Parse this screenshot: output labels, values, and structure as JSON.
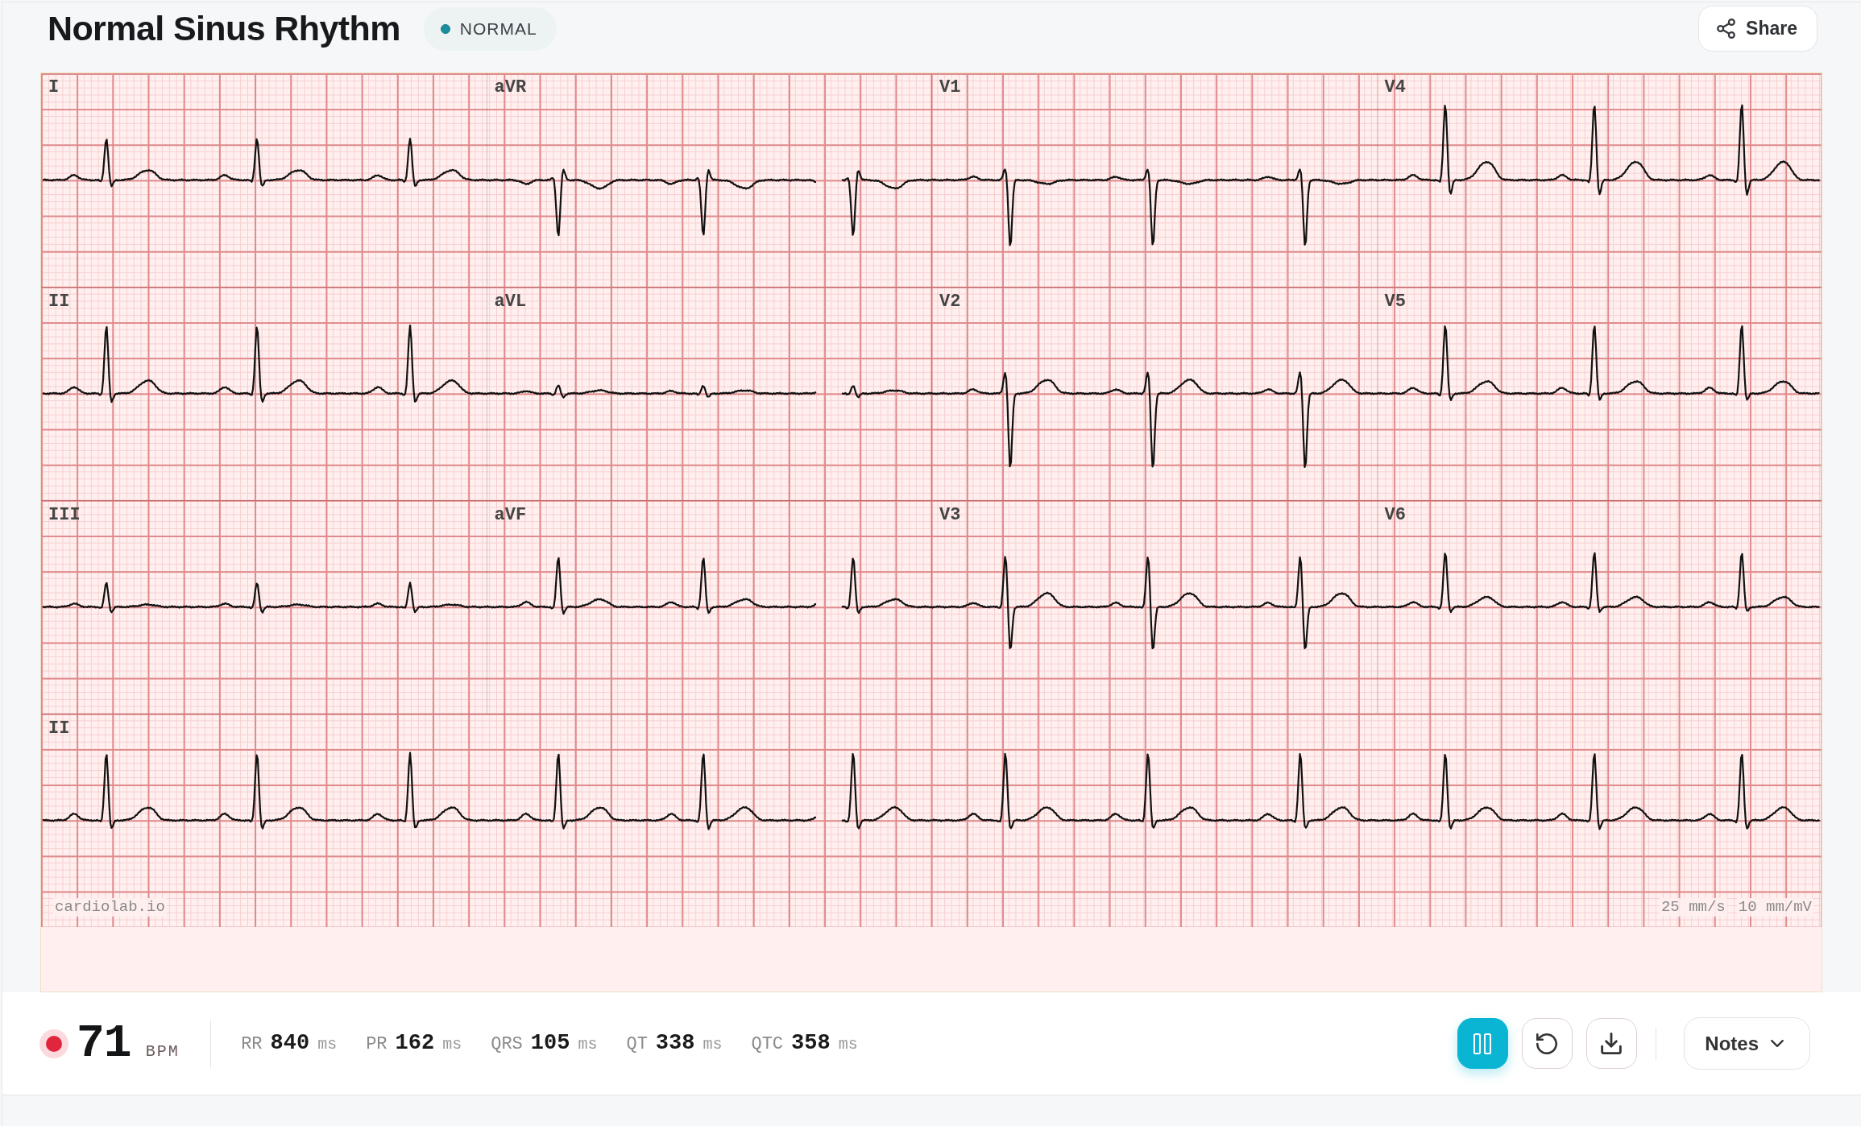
{
  "header": {
    "title": "Normal Sinus Rhythm",
    "status_badge": {
      "label": "NORMAL"
    },
    "share_button": {
      "label": "Share"
    }
  },
  "ecg": {
    "rows": [
      {
        "leads": [
          "I",
          "aVR",
          "V1",
          "V4"
        ]
      },
      {
        "leads": [
          "II",
          "aVL",
          "V2",
          "V5"
        ]
      },
      {
        "leads": [
          "III",
          "aVF",
          "V3",
          "V6"
        ]
      }
    ],
    "rhythm_strip": {
      "lead": "II"
    },
    "watermark": "cardiolab.io",
    "paper_speed": "25 mm/s",
    "gain": "10 mm/mV"
  },
  "vitals": {
    "heart_rate": {
      "value": "71",
      "unit": "BPM"
    },
    "intervals": [
      {
        "label": "RR",
        "value": "840",
        "unit": "ms"
      },
      {
        "label": "PR",
        "value": "162",
        "unit": "ms"
      },
      {
        "label": "QRS",
        "value": "105",
        "unit": "ms"
      },
      {
        "label": "QT",
        "value": "338",
        "unit": "ms"
      },
      {
        "label": "QTC",
        "value": "358",
        "unit": "ms"
      }
    ]
  },
  "controls": {
    "playing": true,
    "notes_button": {
      "label": "Notes",
      "expanded": false
    }
  }
}
